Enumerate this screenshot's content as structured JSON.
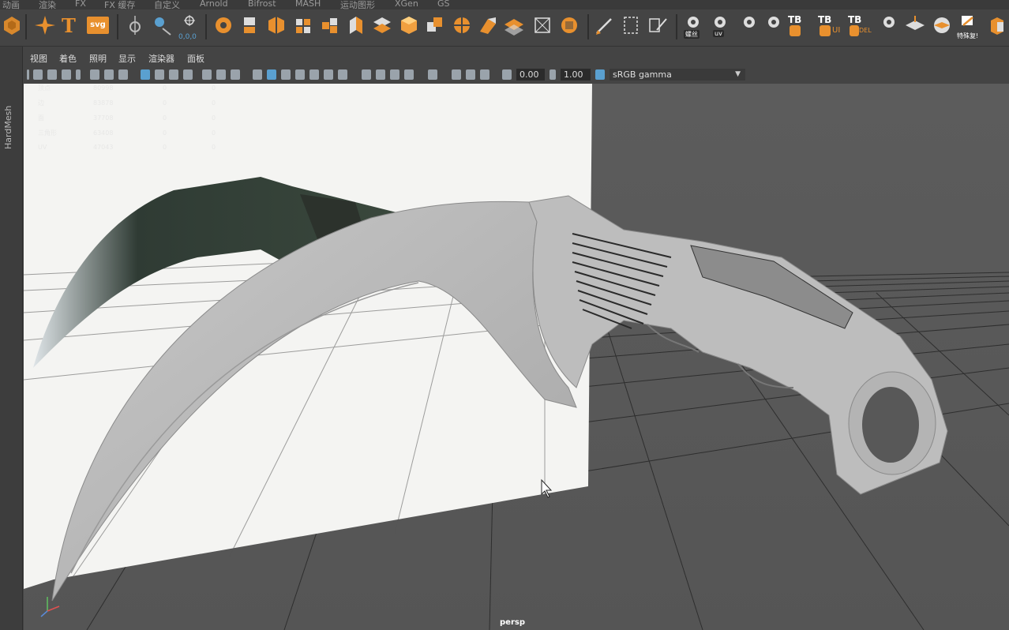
{
  "shelf_tabs": [
    "动画",
    "渲染",
    "FX",
    "FX 缓存",
    "自定义",
    "Arnold",
    "Bifrost",
    "MASH",
    "运动图形",
    "XGen",
    "GS"
  ],
  "shelf": {
    "coord_label": "0,0,0",
    "spiral_label": "螺丝",
    "uv_label": "uv",
    "tb_label": "TB",
    "tb_ui": "UI",
    "tb_del": "DEL",
    "special_label": "特殊复!",
    "svg_label": "svg",
    "text_tool": "T"
  },
  "side_panel": {
    "label": "HardMesh"
  },
  "panel_menu": [
    "视图",
    "着色",
    "照明",
    "显示",
    "渲染器",
    "面板"
  ],
  "panel_toolbar": {
    "exposure": "0.00",
    "gamma": "1.00",
    "color_space": "sRGB gamma"
  },
  "viewport": {
    "camera_name": "persp",
    "hud_rows": [
      {
        "label": "顶点",
        "value": "80998",
        "sel": "0",
        "tri": "0"
      },
      {
        "label": "边",
        "value": "83878",
        "sel": "0",
        "tri": "0"
      },
      {
        "label": "面",
        "value": "37708",
        "sel": "0",
        "tri": "0"
      },
      {
        "label": "三角形",
        "value": "63408",
        "sel": "0",
        "tri": "0"
      },
      {
        "label": "UV",
        "value": "47043",
        "sel": "0",
        "tri": "0"
      }
    ]
  },
  "colors": {
    "accent_orange": "#e8902e",
    "panel_bg": "#444444",
    "viewport_bg": "#5a5a5a",
    "active_tool_blue": "#5aa0d0"
  }
}
